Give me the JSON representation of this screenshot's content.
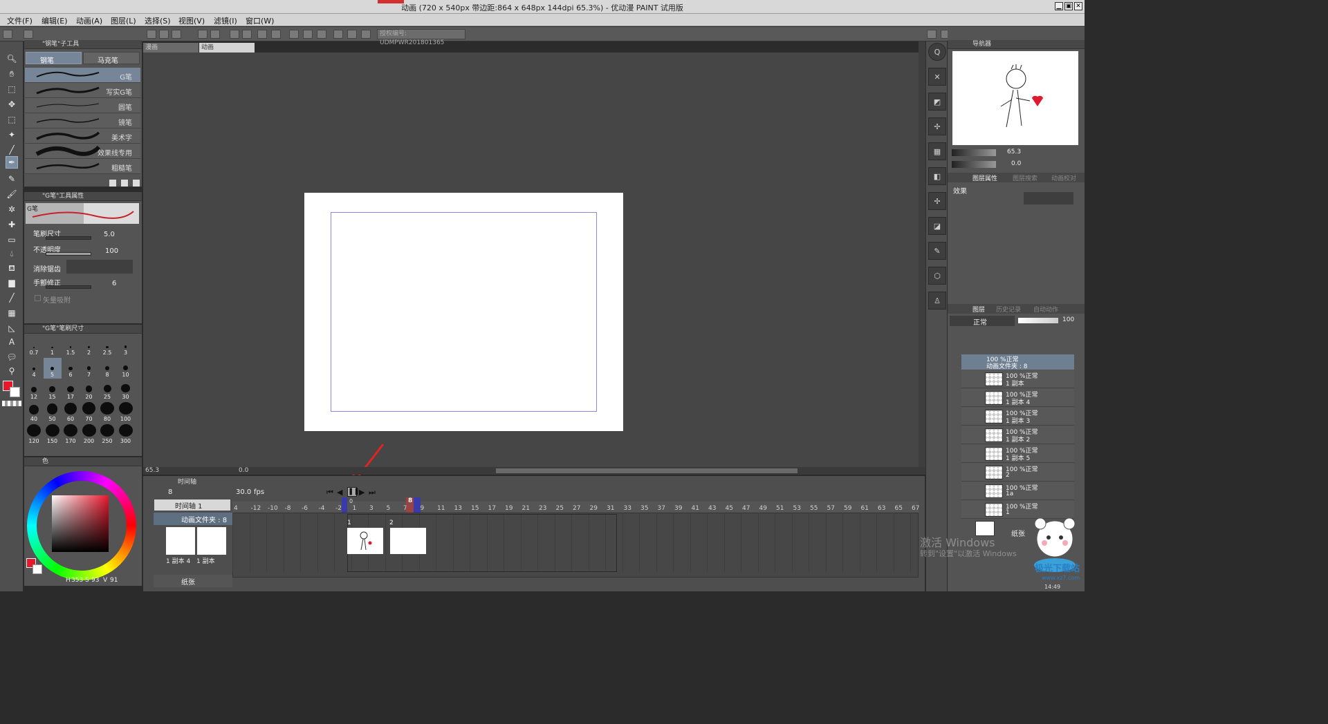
{
  "window": {
    "title": "动画 (720 x 540px 带边距:864 x 648px 144dpi 65.3%)  - 优动漫 PAINT 试用版",
    "min": "▁",
    "max": "▣",
    "close": "✕"
  },
  "menu": [
    "文件(F)",
    "编辑(E)",
    "动画(A)",
    "图层(L)",
    "选择(S)",
    "视图(V)",
    "滤镜(I)",
    "窗口(W)"
  ],
  "toolbar": {
    "license": "授权编号: UDMPWR201801365"
  },
  "tool_panel": {
    "header": "\"钢笔\"子工具",
    "tabs": [
      "钢笔",
      "马克笔"
    ],
    "brushes": [
      "G笔",
      "写实G笔",
      "圆笔",
      "镜笔",
      "美术字",
      "效果线专用",
      "粗糙笔"
    ]
  },
  "tool_props": {
    "header": "\"G笔\"工具属性",
    "preview_label": "G笔",
    "brush_size_label": "笔刷尺寸",
    "brush_size": "5.0",
    "opacity_label": "不透明度",
    "opacity": "100",
    "antialias_label": "消除锯齿",
    "stabilize_label": "手颤修正",
    "stabilize": "6",
    "vector_label": "矢量吸附"
  },
  "size_panel": {
    "header": "\"G笔\"笔刷尺寸",
    "sizes": [
      "0.7",
      "1",
      "1.5",
      "2",
      "2.5",
      "3",
      "4",
      "5",
      "6",
      "7",
      "8",
      "10",
      "12",
      "15",
      "17",
      "20",
      "25",
      "30",
      "40",
      "50",
      "60",
      "70",
      "80",
      "100",
      "120",
      "150",
      "170",
      "200",
      "250",
      "300"
    ]
  },
  "color": {
    "header": "色",
    "main": "#e8182c",
    "sub": "#ffffff",
    "h_label": "H",
    "h": "353",
    "s_label": "S",
    "s": "93",
    "v_label": "V",
    "v": "91"
  },
  "canvas": {
    "tabs": [
      "漫画",
      "动画"
    ],
    "zoom": "65.3",
    "rotate": "0.0"
  },
  "navigator": {
    "header": "导航器",
    "zoom": "65.3",
    "rotate": "0.0"
  },
  "layer_props": {
    "tabs": [
      "图层属性",
      "图层搜索",
      "动画校对"
    ],
    "effect_label": "效果"
  },
  "layers": {
    "tabs": [
      "图层",
      "历史记录",
      "自动动作"
    ],
    "blend": "正常",
    "opacity": "100",
    "folder": {
      "line1": "100 %正常",
      "line2": "动画文件夹 : 8"
    },
    "items": [
      {
        "l1": "100 %正常",
        "l2": "1 副本"
      },
      {
        "l1": "100 %正常",
        "l2": "1 副本 4"
      },
      {
        "l1": "100 %正常",
        "l2": "1 副本 3"
      },
      {
        "l1": "100 %正常",
        "l2": "1 副本 2"
      },
      {
        "l1": "100 %正常",
        "l2": "1 副本 5"
      },
      {
        "l1": "100 %正常",
        "l2": "2"
      },
      {
        "l1": "100 %正常",
        "l2": "1a"
      },
      {
        "l1": "100 %正常",
        "l2": "1"
      }
    ],
    "paper": "纸张"
  },
  "timeline": {
    "header": "时间轴",
    "frame": "8",
    "fps": "30.0",
    "fps_unit": "fps",
    "name": "时间轴 1",
    "folder": "动画文件夹 : 8",
    "track_labels": [
      "1 副本 4",
      "1 副本"
    ],
    "paper": "纸张",
    "current_frame": "8",
    "start_marker": "0",
    "cel_labels": [
      "1",
      "2"
    ],
    "ruler": [
      "4",
      "-12",
      "-10",
      "-8",
      "-6",
      "-4",
      "-2",
      "1",
      "3",
      "5",
      "7",
      "9",
      "11",
      "13",
      "15",
      "17",
      "19",
      "21",
      "23",
      "25",
      "27",
      "29",
      "31",
      "33",
      "35",
      "37",
      "39",
      "41",
      "43",
      "45",
      "47",
      "49",
      "51",
      "53",
      "55",
      "57",
      "59",
      "61",
      "63",
      "65",
      "67"
    ],
    "ruler_major": [
      "1",
      "2"
    ]
  },
  "watermark": {
    "line1": "激活 Windows",
    "line2": "转到\"设置\"以激活 Windows",
    "site": "极光下载站",
    "url": "www.xz7.com"
  },
  "clock": "14:49"
}
